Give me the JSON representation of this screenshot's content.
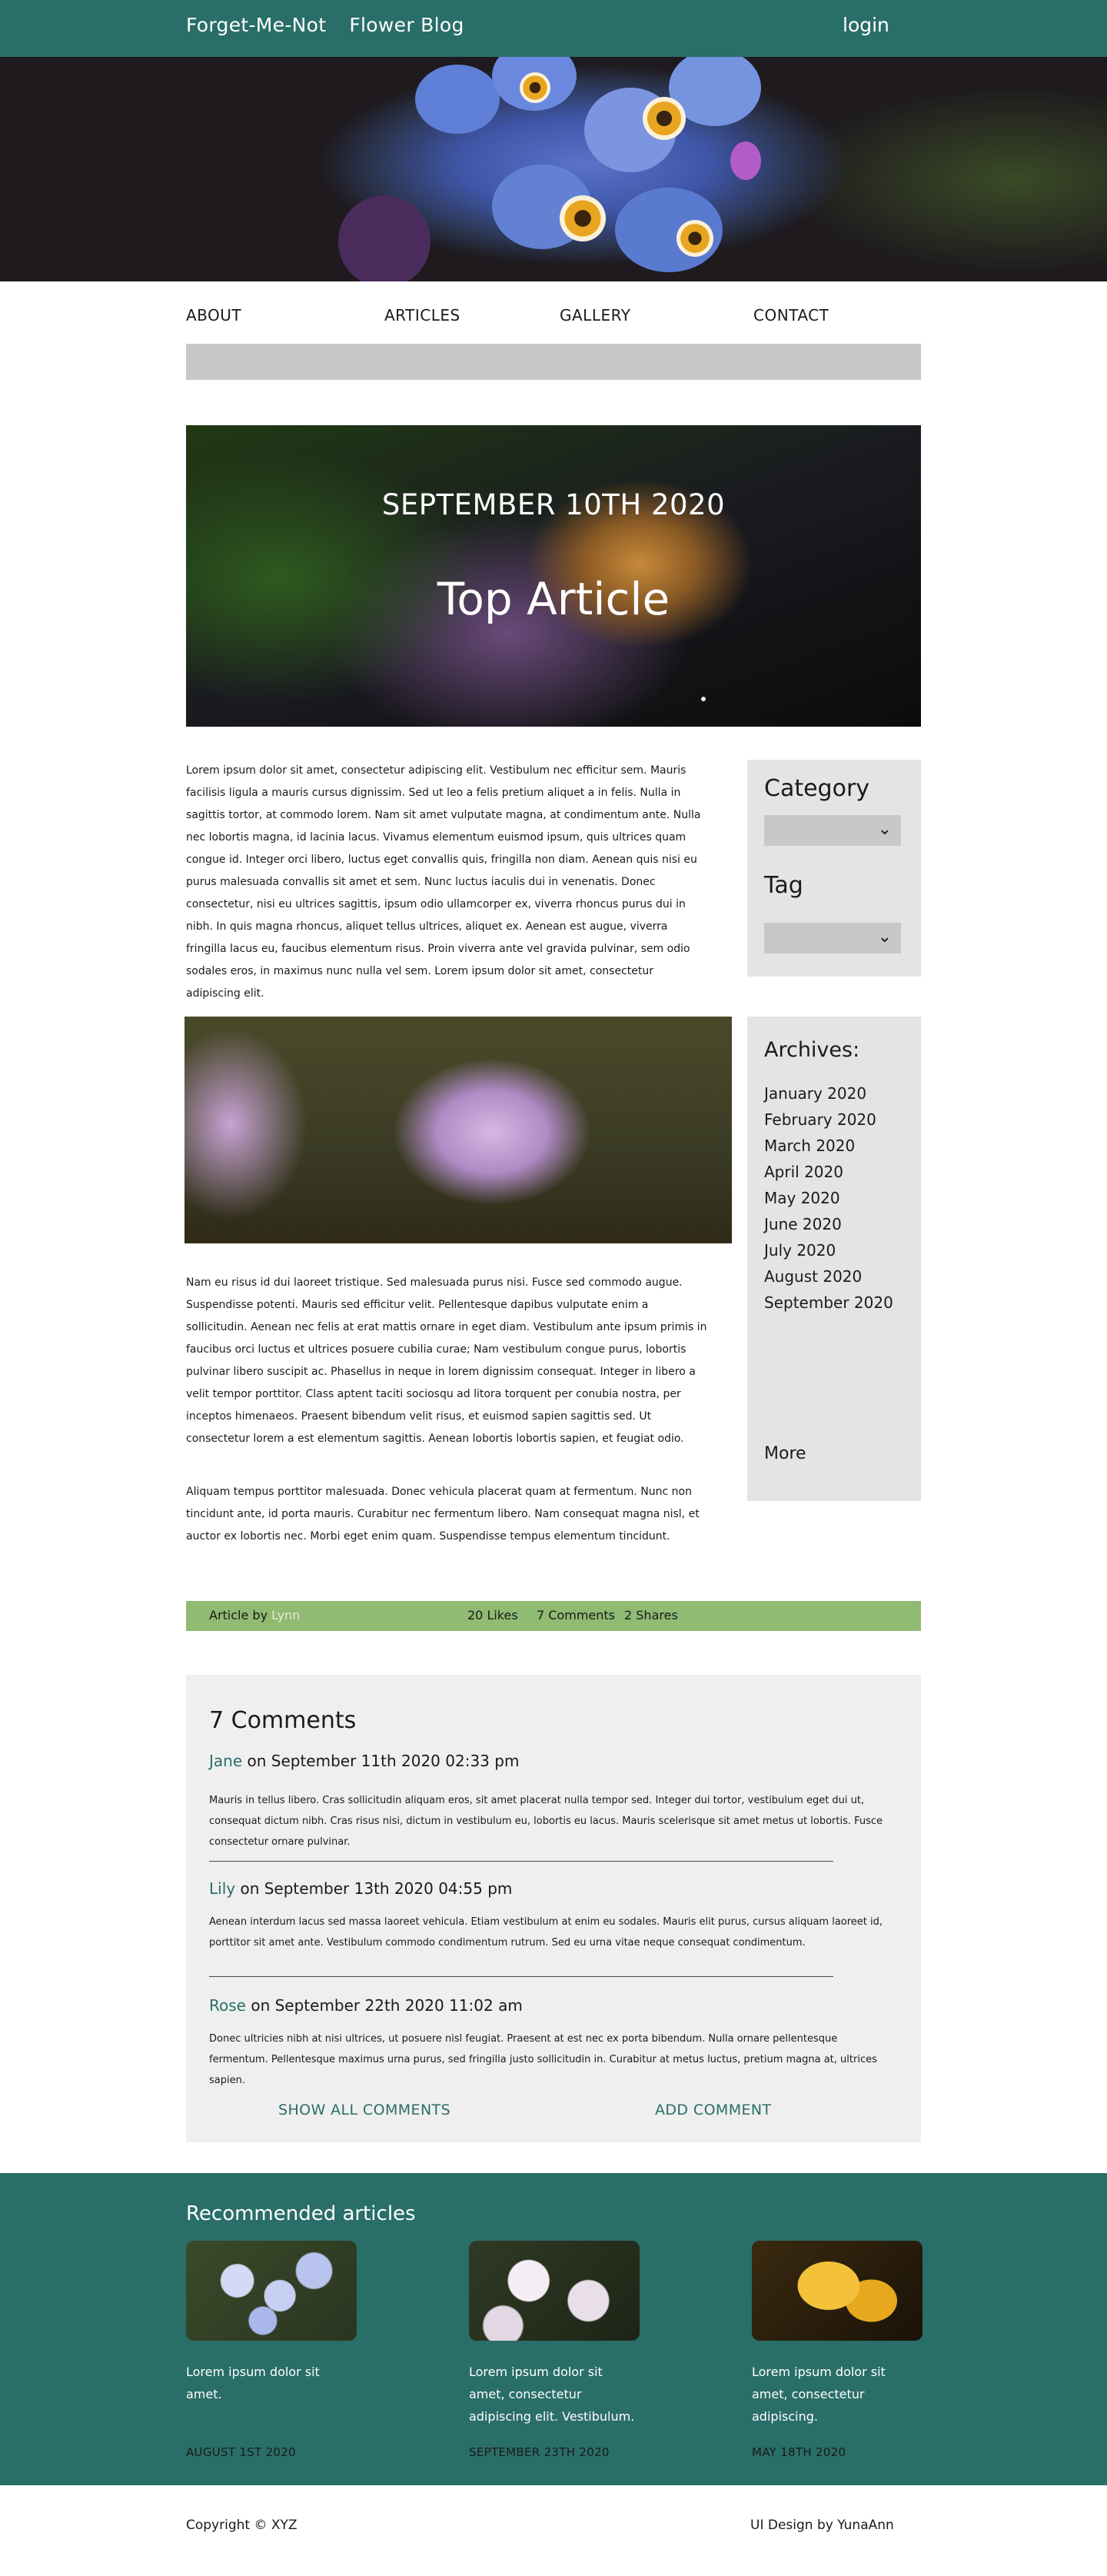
{
  "header": {
    "brand_name": "Forget-Me-Not",
    "brand_suffix": "Flower Blog",
    "login_label": "login"
  },
  "nav": {
    "items": [
      {
        "label": "ABOUT"
      },
      {
        "label": "ARTICLES"
      },
      {
        "label": "GALLERY"
      },
      {
        "label": "CONTACT"
      }
    ]
  },
  "top_article": {
    "date": "SEPTEMBER 10TH 2020",
    "title": "Top Article"
  },
  "article": {
    "paragraph_1": "Lorem ipsum dolor sit amet, consectetur adipiscing elit. Vestibulum nec efficitur sem. Mauris facilisis ligula a mauris cursus dignissim. Sed ut leo a felis pretium aliquet a in felis. Nulla in sagittis tortor, at commodo lorem. Nam sit amet vulputate magna, at condimentum ante. Nulla nec lobortis magna, id lacinia lacus. Vivamus elementum euismod ipsum, quis ultrices quam congue id. Integer orci libero, luctus eget convallis quis, fringilla non diam. Aenean quis nisi eu purus malesuada convallis sit amet et sem. Nunc luctus iaculis dui in venenatis. Donec consectetur, nisi eu ultrices sagittis, ipsum odio ullamcorper ex, viverra rhoncus purus dui in nibh. In quis magna rhoncus, aliquet tellus ultrices, aliquet ex. Aenean est augue, viverra fringilla lacus eu, faucibus elementum risus. Proin viverra ante vel gravida pulvinar, sem odio sodales eros, in maximus nunc nulla vel sem. Lorem ipsum dolor sit amet, consectetur adipiscing elit.",
    "paragraph_2": "Nam eu risus id dui laoreet tristique. Sed malesuada purus nisi. Fusce sed commodo augue. Suspendisse potenti. Mauris sed efficitur velit. Pellentesque dapibus vulputate enim a sollicitudin. Aenean nec felis at erat mattis ornare in eget diam. Vestibulum ante ipsum primis in faucibus orci luctus et ultrices posuere cubilia curae; Nam vestibulum congue purus, lobortis pulvinar libero suscipit ac. Phasellus in neque in lorem dignissim consequat. Integer in libero a velit tempor porttitor. Class aptent taciti sociosqu ad litora torquent per conubia nostra, per inceptos himenaeos. Praesent bibendum velit risus, et euismod sapien sagittis sed. Ut consectetur lorem a est elementum sagittis. Aenean lobortis lobortis sapien, et feugiat odio.",
    "paragraph_3": "Aliquam tempus porttitor malesuada. Donec vehicula placerat quam at fermentum. Nunc non tincidunt ante, id porta mauris. Curabitur nec fermentum libero. Nam consequat magna nisl, et auctor ex lobortis nec. Morbi eget enim quam. Suspendisse tempus elementum tincidunt."
  },
  "sidebar": {
    "category_label": "Category",
    "tag_label": "Tag",
    "archives_title": "Archives:",
    "months": [
      "January 2020",
      "February 2020",
      "March 2020",
      "April 2020",
      "May 2020",
      "June 2020",
      "July 2020",
      "August 2020",
      "September 2020"
    ],
    "more_label": "More"
  },
  "meta": {
    "article_by_label": "Article by",
    "author": "Lynn",
    "likes": "20 Likes",
    "comments": "7 Comments",
    "shares": "2 Shares"
  },
  "comments": {
    "title": "7 Comments",
    "items": [
      {
        "author": "Jane",
        "when": "on September 11th 2020 02:33 pm",
        "text": "Mauris in tellus libero. Cras sollicitudin aliquam eros, sit amet placerat nulla tempor sed. Integer dui tortor, vestibulum eget dui ut, consequat dictum nibh. Cras risus nisi, dictum in vestibulum eu, lobortis eu lacus. Mauris scelerisque sit amet metus ut lobortis. Fusce consectetur ornare pulvinar."
      },
      {
        "author": "Lily",
        "when": "on September 13th 2020 04:55 pm",
        "text": "Aenean interdum lacus sed massa laoreet vehicula. Etiam vestibulum at enim eu sodales. Mauris elit purus, cursus aliquam laoreet id, porttitor sit amet ante. Vestibulum commodo condimentum rutrum. Sed eu urna vitae neque consequat condimentum."
      },
      {
        "author": "Rose",
        "when": "on September 22th 2020 11:02 am",
        "text": "Donec ultricies nibh at nisi ultrices, ut posuere nisl feugiat. Praesent at est nec ex porta bibendum. Nulla ornare pellentesque fermentum. Pellentesque maximus urna purus, sed fringilla justo sollicitudin in. Curabitur at metus luctus, pretium magna at, ultrices sapien."
      }
    ],
    "show_all_label": "SHOW ALL COMMENTS",
    "add_label": "ADD COMMENT"
  },
  "recommended": {
    "title": "Recommended articles",
    "items": [
      {
        "text": "Lorem ipsum dolor sit amet.",
        "date": "AUGUST 1ST 2020"
      },
      {
        "text": "Lorem ipsum dolor sit amet, consectetur adipiscing elit. Vestibulum.",
        "date": "SEPTEMBER 23TH 2020"
      },
      {
        "text": "Lorem ipsum dolor sit amet, consectetur adipiscing.",
        "date": "MAY 18TH 2020"
      }
    ]
  },
  "footer": {
    "copyright": "Copyright © XYZ",
    "credit": "UI Design by YunaAnn"
  },
  "colors": {
    "brand": "#2a6e69",
    "meta_bar": "#8fbb72",
    "panel": "#e4e4e4",
    "comments_bg": "#efefef"
  }
}
